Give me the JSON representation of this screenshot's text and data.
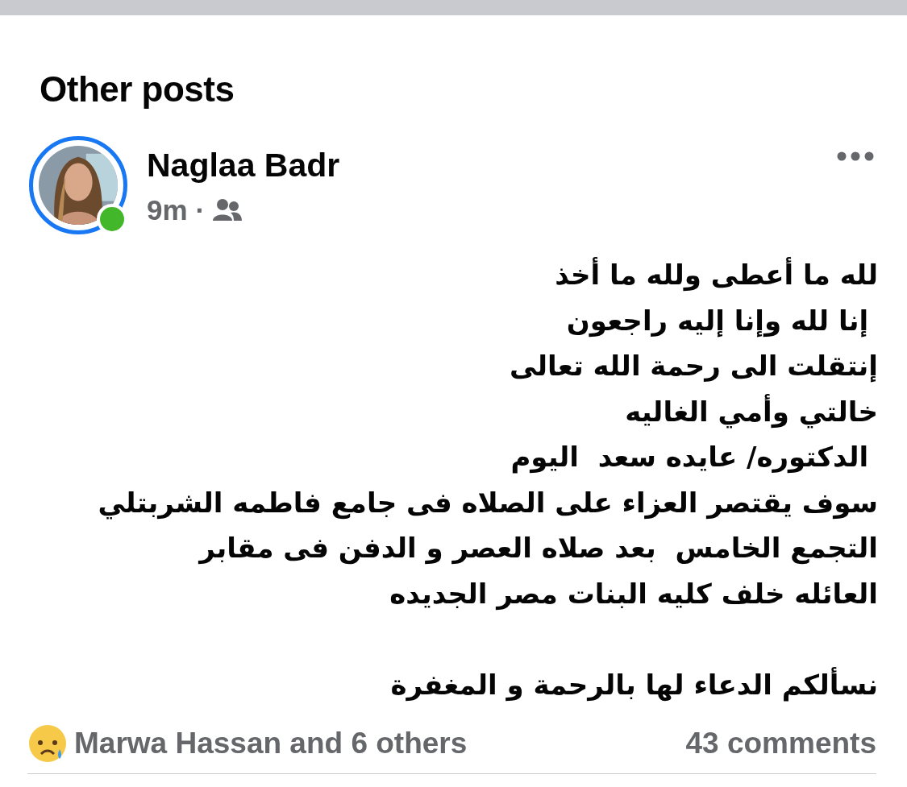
{
  "section_title": "Other posts",
  "post": {
    "author": "Naglaa Badr",
    "online": true,
    "story_ring": true,
    "time": "9m",
    "separator": "·",
    "text": "لله ما أعطى ولله ما أخذ\n إنا لله وإنا إليه راجعون\nإنتقلت الى رحمة الله تعالى\nخالتي وأمي الغاليه\n الدكتوره/ عايده سعد  اليوم\nسوف يقتصر العزاء على الصلاه فى جامع فاطمه الشربتلي\nالتجمع الخامس  بعد صلاه العصر و الدفن فى مقابر\nالعائله خلف كليه البنات مصر الجديده\n\nنسألكم الدعاء لها بالرحمة و المغفرة",
    "reactions": "Marwa Hassan and 6 others",
    "comments": "43 comments"
  }
}
